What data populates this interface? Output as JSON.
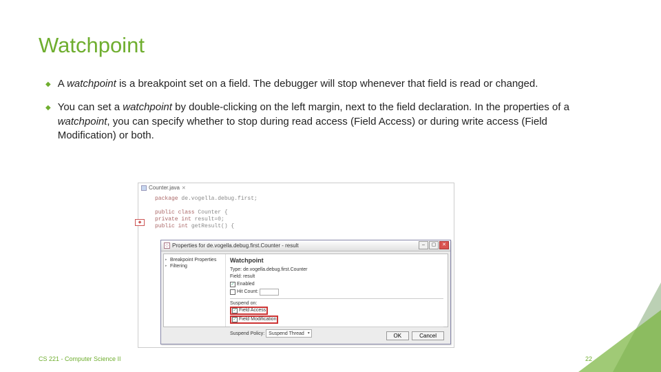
{
  "title": "Watchpoint",
  "bullets": {
    "b0_pre": "A ",
    "b0_em": "watchpoint",
    "b0_post": " is a breakpoint set on a field. The debugger will stop whenever that field is read or changed.",
    "b1_pre": "You can set a ",
    "b1_em1": "watchpoint",
    "b1_mid": " by double-clicking on the left margin, next to the field declaration. In the properties of a ",
    "b1_em2": "watchpoint",
    "b1_post": ", you can specify whether to stop during read access (Field Access) or during write access (Field Modification) or both."
  },
  "tab_label": "Counter.java",
  "code": {
    "l1_kw": "package ",
    "l1_rest": "de.vogella.debug.first;",
    "l2_kw": "public class ",
    "l2_rest": "Counter {",
    "l3_kw": "  private int ",
    "l3_rest": "result=0;",
    "l4_kw": "  public int ",
    "l4_rest": "getResult() {"
  },
  "dialog": {
    "title": "Properties for de.vogella.debug.first.Counter - result",
    "side1": "Breakpoint Properties",
    "side2": "Filtering",
    "heading": "Watchpoint",
    "type_label": "Type:",
    "type_value": "de.vogella.debug.first.Counter",
    "field_label": "Field:",
    "field_value": "result",
    "enabled": "Enabled",
    "hitcount": "Hit Count:",
    "suspend_on": "Suspend on:",
    "field_access": "Field Access",
    "field_mod": "Field Modification",
    "suspend_policy_label": "Suspend Policy:",
    "suspend_policy_value": "Suspend Thread",
    "ok": "OK",
    "cancel": "Cancel"
  },
  "footer": "CS 221 - Computer Science II",
  "page": "22"
}
